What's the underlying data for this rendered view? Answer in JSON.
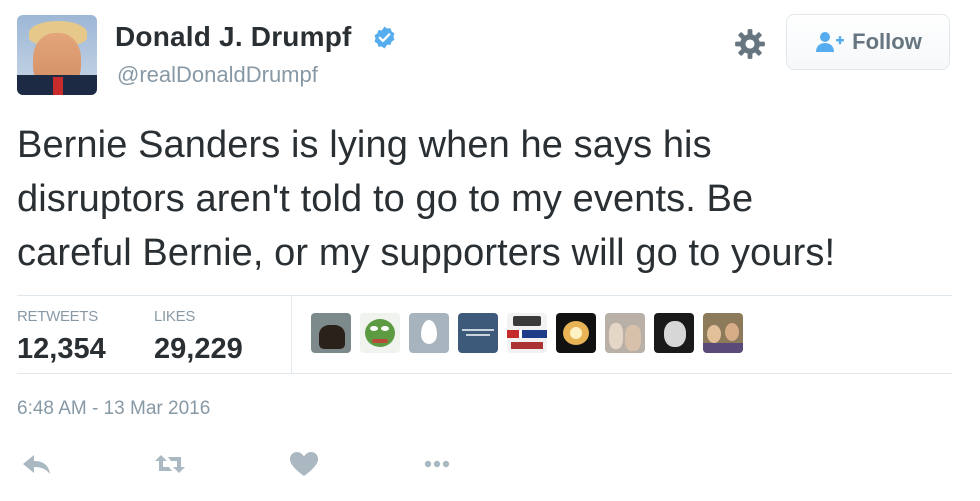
{
  "tweet": {
    "author": {
      "display_name": "Donald J. Drumpf",
      "handle": "@realDonaldDrumpf",
      "verified": true,
      "avatar_icon": "profile-photo"
    },
    "follow_button": {
      "label": "Follow",
      "icon": "add-user-icon"
    },
    "settings_icon": "gear-icon",
    "text_lines": [
      "Bernie Sanders is lying when he says his",
      "disruptors aren't told to go to my events. Be",
      "careful Bernie, or my supporters will go to yours!"
    ],
    "stats": {
      "retweets_label": "RETWEETS",
      "retweets_value": "12,354",
      "likes_label": "LIKES",
      "likes_value": "29,229"
    },
    "likers_count_shown": 9,
    "timestamp": "6:48 AM - 13 Mar 2016",
    "actions": [
      "reply-icon",
      "retweet-icon",
      "like-icon",
      "more-icon"
    ]
  },
  "colors": {
    "text": "#292f33",
    "muted": "#8899a6",
    "verified_blue": "#55acee",
    "border": "#e1e8ed"
  }
}
